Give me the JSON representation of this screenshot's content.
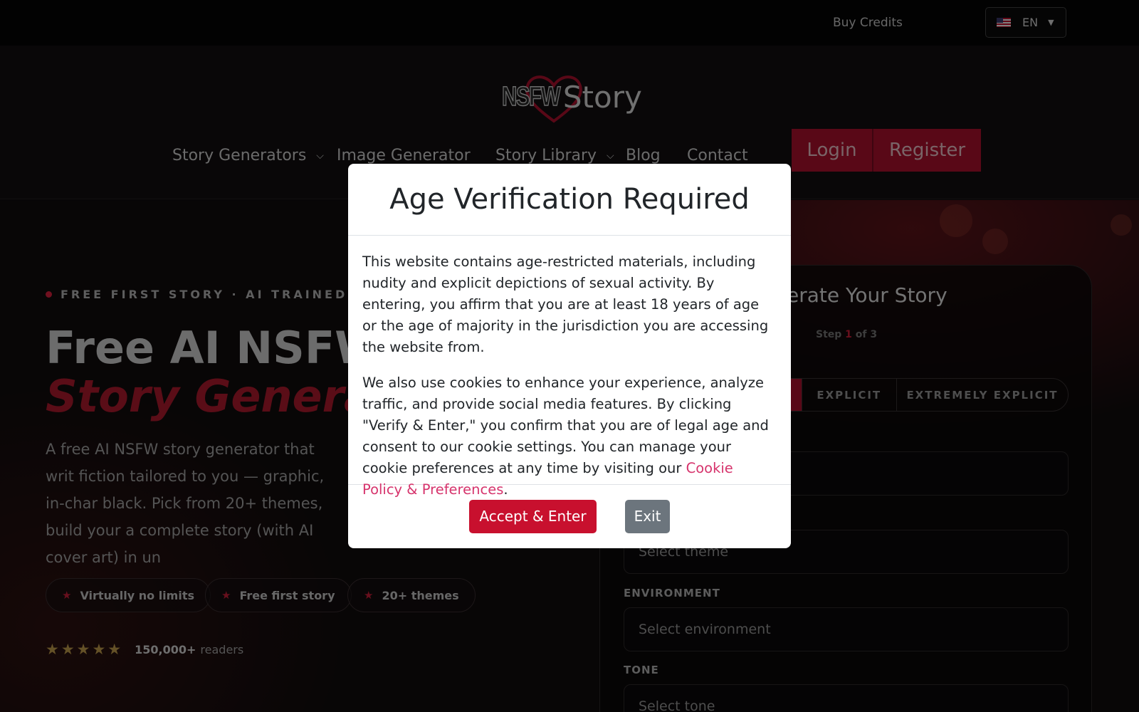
{
  "topbar": {
    "buy_credits": "Buy Credits",
    "language": {
      "code": "EN",
      "flag_icon": "us-flag-icon"
    }
  },
  "header": {
    "logo": {
      "part1": "NSFW",
      "part2": "Story"
    },
    "nav": [
      {
        "label": "Story Generators",
        "has_dropdown": true
      },
      {
        "label": "Image Generator",
        "has_dropdown": false
      },
      {
        "label": "Story Library",
        "has_dropdown": true
      },
      {
        "label": "Blog",
        "has_dropdown": false
      },
      {
        "label": "Contact",
        "has_dropdown": false
      }
    ],
    "login": "Login",
    "register": "Register"
  },
  "hero": {
    "eyebrow": "FREE FIRST STORY · AI TRAINED ON E",
    "title_line1": "Free AI NSFW",
    "title_line2": "Story Generat",
    "description": "A free AI NSFW story generator that writ fiction tailored to you — graphic, in-char black. Pick from 20+ themes, build your a complete story (with AI cover art) in un",
    "pills": [
      "Virtually no limits",
      "Free first story",
      "20+ themes"
    ],
    "rating": {
      "stars": "★★★★★",
      "count": "150,000+",
      "suffix": "readers"
    }
  },
  "story_panel": {
    "title": "erate Your Story",
    "step": {
      "prefix": "Step",
      "current": "1",
      "of": "of",
      "total": "3"
    },
    "levels": [
      "EXPLICIT",
      "EXTREMELY EXPLICIT"
    ],
    "theme_placeholder": "Select theme",
    "environment_label": "ENVIRONMENT",
    "environment_placeholder": "Select environment",
    "tone_label": "TONE",
    "tone_placeholder": "Select tone"
  },
  "modal": {
    "title": "Age Verification Required",
    "paragraph1": "This website contains age-restricted materials, including nudity and explicit depictions of sexual activity. By entering, you affirm that you are at least 18 years of age or the age of majority in the jurisdiction you are accessing the website from.",
    "paragraph2_before_link": "We also use cookies to enhance your experience, analyze traffic, and provide social media features. By clicking \"Verify & Enter,\" you confirm that you are of legal age and consent to our cookie settings. You can manage your cookie preferences at any time by visiting our ",
    "paragraph2_link": "Cookie Policy & Preferences",
    "paragraph2_after_link": ".",
    "accept_button": "Accept & Enter",
    "exit_button": "Exit"
  },
  "colors": {
    "brand_red": "#c8102e",
    "link_pink": "#d6336c",
    "exit_gray": "#6c757d"
  }
}
